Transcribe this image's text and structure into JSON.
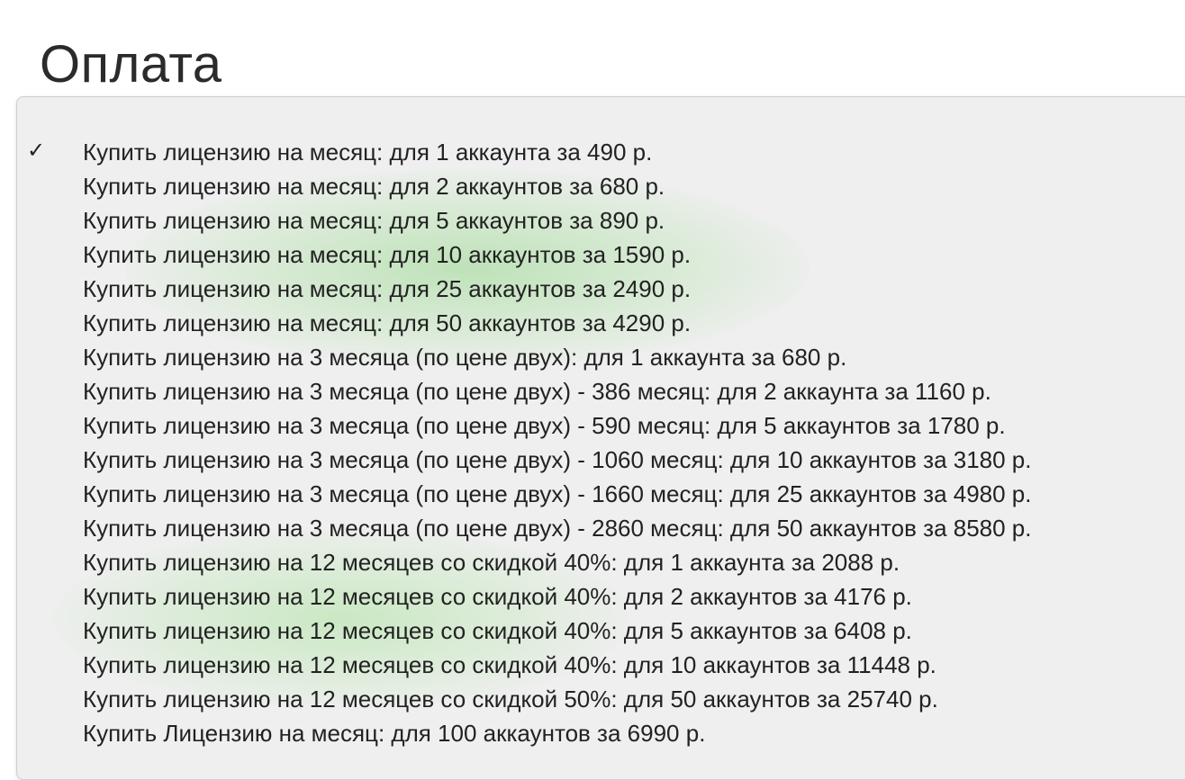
{
  "page": {
    "title": "Оплата"
  },
  "dropdown": {
    "selected_index": 0,
    "check_glyph": "✓",
    "items": [
      {
        "label": "Купить лицензию на месяц: для 1 аккаунта за 490 р."
      },
      {
        "label": "Купить лицензию на месяц: для 2 аккаунтов за 680 р."
      },
      {
        "label": "Купить лицензию на месяц: для 5 аккаунтов за 890 р."
      },
      {
        "label": "Купить лицензию на месяц: для 10 аккаунтов за 1590 р."
      },
      {
        "label": "Купить лицензию на месяц: для 25 аккаунтов за 2490 р."
      },
      {
        "label": "Купить лицензию на месяц: для 50 аккаунтов за 4290 р."
      },
      {
        "label": "Купить лицензию на 3 месяца (по цене двух): для 1 аккаунта за 680 р."
      },
      {
        "label": "Купить лицензию на 3 месяца (по цене двух) - 386 месяц: для 2 аккаунта за 1160 р."
      },
      {
        "label": "Купить лицензию на 3 месяца (по цене двух) - 590 месяц: для 5 аккаунтов за 1780 р."
      },
      {
        "label": "Купить лицензию на 3 месяца (по цене двух) - 1060 месяц: для 10 аккаунтов за 3180 р."
      },
      {
        "label": "Купить лицензию на 3 месяца (по цене двух) - 1660 месяц: для 25 аккаунтов за 4980 р."
      },
      {
        "label": "Купить лицензию на 3 месяца (по цене двух) - 2860 месяц: для 50 аккаунтов за 8580 р."
      },
      {
        "label": "Купить лицензию на 12 месяцев со скидкой 40%: для 1 аккаунта за 2088 р."
      },
      {
        "label": "Купить лицензию на 12 месяцев со скидкой 40%: для 2 аккаунтов за 4176 р."
      },
      {
        "label": "Купить лицензию на 12 месяцев со скидкой 40%: для 5 аккаунтов за 6408 р."
      },
      {
        "label": "Купить лицензию на 12 месяцев со скидкой 40%: для 10 аккаунтов за 11448 р."
      },
      {
        "label": "Купить лицензию на 12 месяцев со скидкой 50%: для 50 аккаунтов за 25740 р."
      },
      {
        "label": "Купить Лицензию на месяц: для 100 аккаунтов за 6990 р."
      }
    ]
  }
}
